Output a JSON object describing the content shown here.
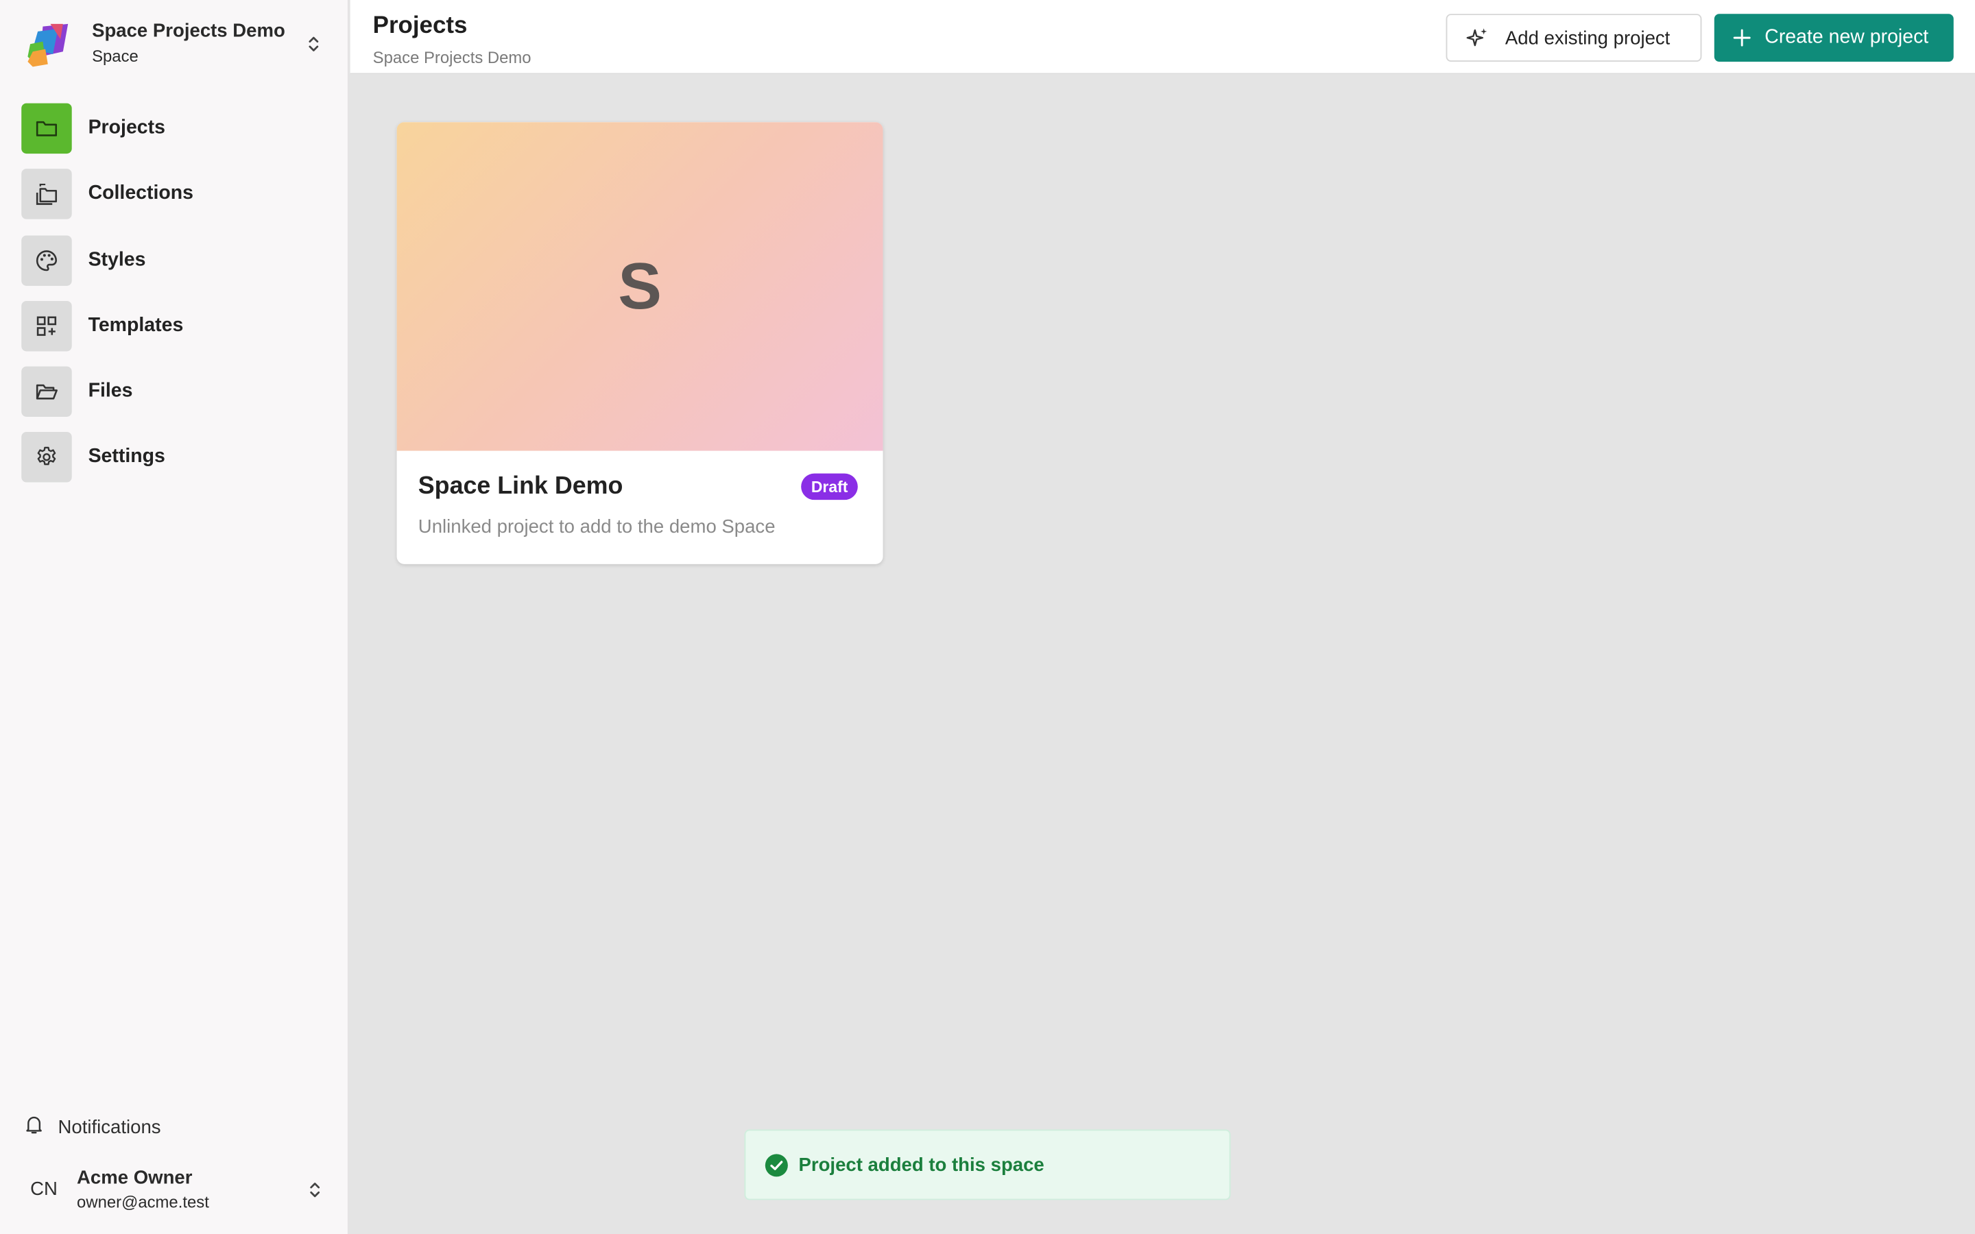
{
  "workspace": {
    "name": "Space Projects Demo",
    "type": "Space",
    "logo_colors": [
      "#f4a13b",
      "#2f8fd9",
      "#8a3fd1",
      "#5bbf3a",
      "#e0506e"
    ]
  },
  "sidebar": {
    "items": [
      {
        "label": "Projects",
        "icon": "folder-icon",
        "active": true
      },
      {
        "label": "Collections",
        "icon": "collections-icon",
        "active": false
      },
      {
        "label": "Styles",
        "icon": "palette-icon",
        "active": false
      },
      {
        "label": "Templates",
        "icon": "grid-plus-icon",
        "active": false
      },
      {
        "label": "Files",
        "icon": "folder-open-icon",
        "active": false
      },
      {
        "label": "Settings",
        "icon": "gear-icon",
        "active": false
      }
    ],
    "notifications_label": "Notifications",
    "user": {
      "initials": "CN",
      "name": "Acme Owner",
      "email": "owner@acme.test"
    }
  },
  "header": {
    "title": "Projects",
    "subtitle": "Space Projects Demo",
    "add_existing_label": "Add existing project",
    "create_new_label": "Create new project"
  },
  "projects": [
    {
      "cover_letter": "S",
      "title": "Space Link Demo",
      "status": "Draft",
      "description": "Unlinked project to add to the demo Space"
    }
  ],
  "toast": {
    "message": "Project added to this space"
  },
  "colors": {
    "accent": "#0f8c7a",
    "active_nav": "#5bb82e",
    "draft_badge": "#8a2ee6",
    "toast_text": "#1b7f3d"
  }
}
